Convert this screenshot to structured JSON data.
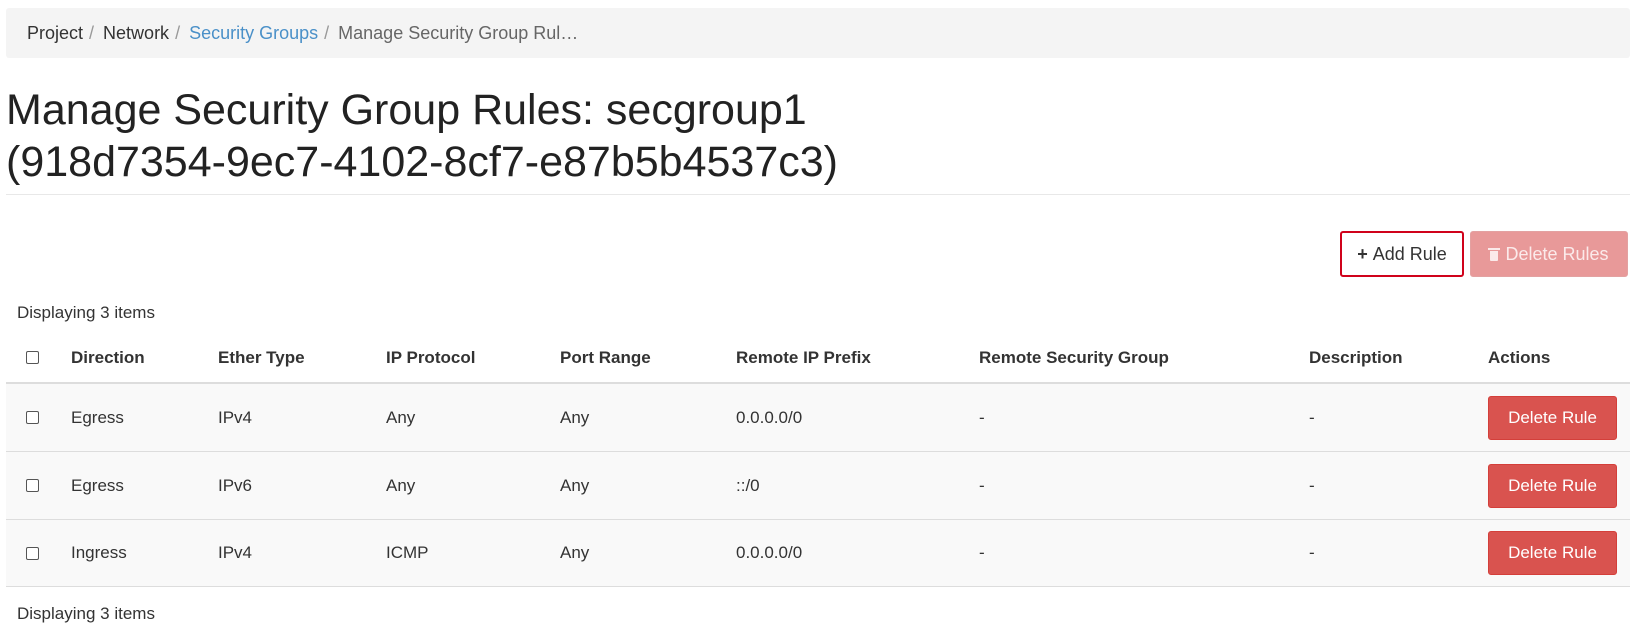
{
  "breadcrumb": {
    "items": [
      {
        "label": "Project"
      },
      {
        "label": "Network"
      },
      {
        "label": "Security Groups"
      },
      {
        "label": "Manage Security Group Rul…"
      }
    ],
    "separator": "/"
  },
  "page": {
    "title_line1": "Manage Security Group Rules: secgroup1",
    "title_line2": "(918d7354-9ec7-4102-8cf7-e87b5b4537c3)"
  },
  "toolbar": {
    "add_icon": "+",
    "add_label": "Add Rule",
    "delete_label": "Delete Rules",
    "delete_icon_name": "trash-icon"
  },
  "table": {
    "count_top": "Displaying 3 items",
    "count_bottom": "Displaying 3 items",
    "columns": {
      "direction": "Direction",
      "ether_type": "Ether Type",
      "ip_protocol": "IP Protocol",
      "port_range": "Port Range",
      "remote_ip_prefix": "Remote IP Prefix",
      "remote_security_group": "Remote Security Group",
      "description": "Description",
      "actions": "Actions"
    },
    "rows": [
      {
        "direction": "Egress",
        "ether_type": "IPv4",
        "ip_protocol": "Any",
        "port_range": "Any",
        "remote_ip_prefix": "0.0.0.0/0",
        "remote_security_group": "-",
        "description": "-",
        "action_label": "Delete Rule"
      },
      {
        "direction": "Egress",
        "ether_type": "IPv6",
        "ip_protocol": "Any",
        "port_range": "Any",
        "remote_ip_prefix": "::/0",
        "remote_security_group": "-",
        "description": "-",
        "action_label": "Delete Rule"
      },
      {
        "direction": "Ingress",
        "ether_type": "IPv4",
        "ip_protocol": "ICMP",
        "port_range": "Any",
        "remote_ip_prefix": "0.0.0.0/0",
        "remote_security_group": "-",
        "description": "-",
        "action_label": "Delete Rule"
      }
    ]
  },
  "colors": {
    "link": "#4a90c8",
    "danger": "#d9534f",
    "highlight_border": "#d0021b"
  }
}
